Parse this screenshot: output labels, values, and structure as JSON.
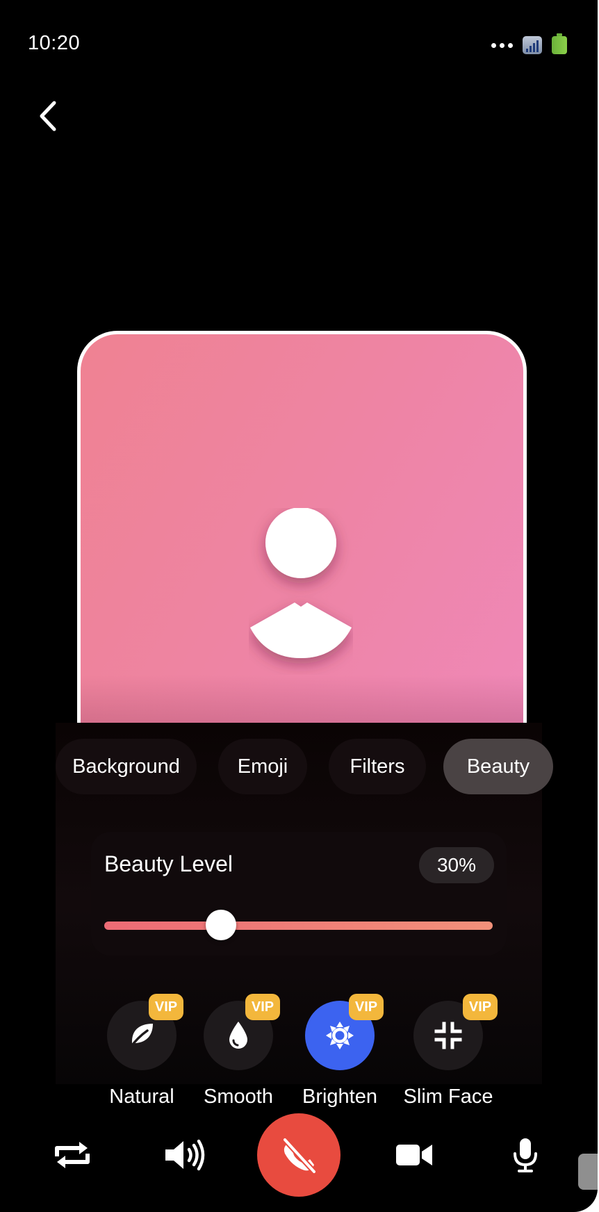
{
  "status_bar": {
    "time": "10:20",
    "signal_icon": "signal-icon",
    "battery_icon": "battery-icon",
    "more_icon": "more-dots-icon"
  },
  "nav": {
    "back_icon": "chevron-left-icon"
  },
  "preview": {
    "avatar_icon": "person-avatar-icon"
  },
  "tabs": [
    {
      "label": "Background",
      "active": false
    },
    {
      "label": "Emoji",
      "active": false
    },
    {
      "label": "Filters",
      "active": false
    },
    {
      "label": "Beauty",
      "active": true
    }
  ],
  "beauty": {
    "label": "Beauty Level",
    "value_text": "30%",
    "value": 0.3
  },
  "options": [
    {
      "label": "Natural",
      "icon": "leaf-icon",
      "badge": "VIP",
      "active": false
    },
    {
      "label": "Smooth",
      "icon": "droplet-icon",
      "badge": "VIP",
      "active": false
    },
    {
      "label": "Brighten",
      "icon": "sun-icon",
      "badge": "VIP",
      "active": true
    },
    {
      "label": "Slim Face",
      "icon": "compress-icon",
      "badge": "VIP",
      "active": false
    }
  ],
  "controls": [
    {
      "name": "switch-camera",
      "icon": "repeat-icon"
    },
    {
      "name": "speaker",
      "icon": "speaker-icon"
    },
    {
      "name": "end-call",
      "icon": "phone-slash-icon"
    },
    {
      "name": "video",
      "icon": "video-camera-icon"
    },
    {
      "name": "microphone",
      "icon": "microphone-icon"
    }
  ],
  "colors": {
    "accent": "#3c63f0",
    "end_call": "#e84b3f",
    "vip": "#f3b73c",
    "preview_bg": "#ee84a4"
  }
}
